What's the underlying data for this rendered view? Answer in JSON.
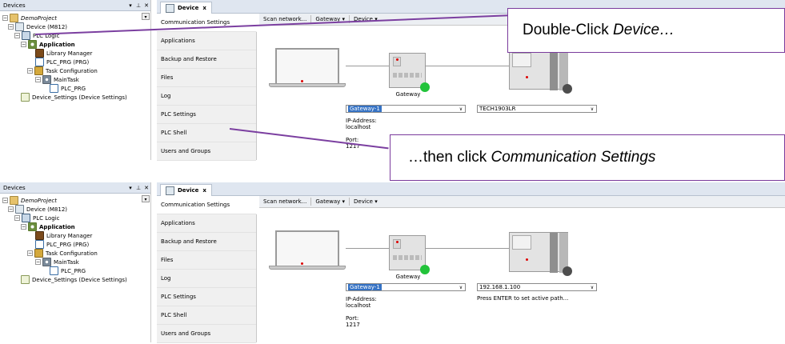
{
  "devices_panel": {
    "title": "Devices",
    "controls": [
      "▾",
      "⊥",
      "✕"
    ],
    "tree": [
      {
        "label": "DemoProject",
        "italic": true,
        "expander": "−",
        "icon": "project-icon"
      },
      {
        "label": "Device (M812)",
        "expander": "−",
        "icon": "device-icon"
      },
      {
        "label": "PLC Logic",
        "expander": "−",
        "icon": "plc-logic-icon"
      },
      {
        "label": "Application",
        "bold": true,
        "expander": "−",
        "icon": "application-icon"
      },
      {
        "label": "Library Manager",
        "icon": "library-manager-icon"
      },
      {
        "label": "PLC_PRG (PRG)",
        "icon": "program-icon"
      },
      {
        "label": "Task Configuration",
        "expander": "−",
        "icon": "task-config-icon"
      },
      {
        "label": "MainTask",
        "expander": "−",
        "icon": "main-task-icon"
      },
      {
        "label": "PLC_PRG",
        "icon": "program-icon"
      },
      {
        "label": "Device_Settings (Device Settings)",
        "icon": "settings-icon"
      }
    ]
  },
  "editor": {
    "tab_label": "Device",
    "tab_close": "x",
    "nav_items": [
      "Communication Settings",
      "Applications",
      "Backup and Restore",
      "Files",
      "Log",
      "PLC Settings",
      "PLC Shell",
      "Users and Groups"
    ],
    "toolbar": {
      "scan": "Scan network...",
      "gateway": "Gateway ▾",
      "device": "Device ▾"
    },
    "gateway_label": "Gateway",
    "gateway_select": "Gateway-1",
    "ip_label": "IP-Address:",
    "ip_value": "localhost",
    "port_label": "Port:",
    "port_value": "1217"
  },
  "panel_top": {
    "device_select": "TECH1903LR",
    "callout_1": {
      "prefix": "Double-Click ",
      "emph": "Device…"
    },
    "callout_2": {
      "prefix": "…then click ",
      "emph": "Communication Settings"
    }
  },
  "panel_bottom": {
    "device_select": "192.168.1.100",
    "hint": "Press ENTER to set active path..."
  },
  "colors": {
    "accent_purple": "#7b3fa0",
    "status_online": "#22c33a",
    "status_offline": "#4d4d4d",
    "selection": "#3572c4"
  }
}
